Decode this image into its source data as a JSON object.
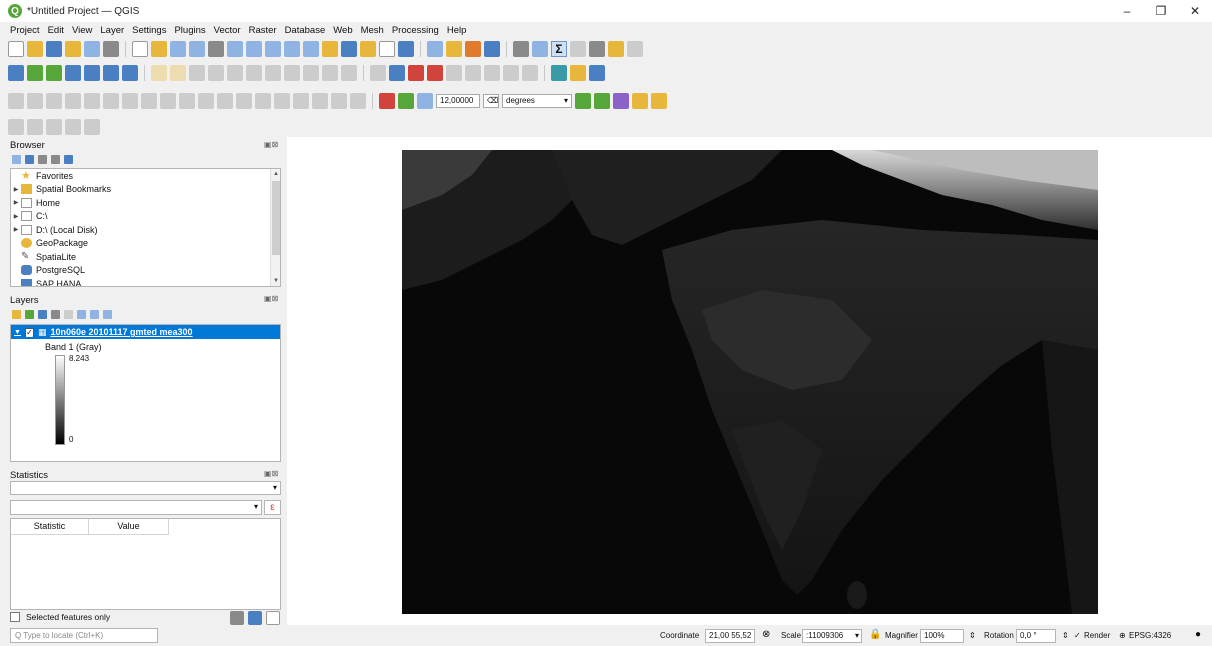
{
  "window": {
    "title": "*Untitled Project — QGIS",
    "app_icon": "Q",
    "controls": [
      "–",
      "❐",
      "✕"
    ]
  },
  "menubar": [
    "Project",
    "Edit",
    "View",
    "Layer",
    "Settings",
    "Plugins",
    "Vector",
    "Raster",
    "Database",
    "Web",
    "Mesh",
    "Processing",
    "Help"
  ],
  "toolbar": {
    "snap_tolerance": "12,00000",
    "units": "degrees"
  },
  "browser": {
    "title": "Browser",
    "items": [
      {
        "label": "Favorites",
        "icon": "star-icon",
        "arrow": ""
      },
      {
        "label": "Spatial Bookmarks",
        "icon": "bookmark-icon",
        "arrow": "▶"
      },
      {
        "label": "Home",
        "icon": "home-folder-icon",
        "arrow": "▶"
      },
      {
        "label": "C:\\",
        "icon": "drive-icon",
        "arrow": "▶"
      },
      {
        "label": "D:\\ (Local Disk)",
        "icon": "drive-icon",
        "arrow": "▶"
      },
      {
        "label": "GeoPackage",
        "icon": "geopackage-icon",
        "arrow": ""
      },
      {
        "label": "SpatiaLite",
        "icon": "spatialite-icon",
        "arrow": ""
      },
      {
        "label": "PostgreSQL",
        "icon": "postgresql-icon",
        "arrow": ""
      },
      {
        "label": "SAP HANA",
        "icon": "saphana-icon",
        "arrow": ""
      }
    ]
  },
  "layers": {
    "title": "Layers",
    "layer_name": "10n060e 20101117 gmted mea300",
    "band_label": "Band 1 (Gray)",
    "max_value": "8.243",
    "min_value": "0"
  },
  "statistics": {
    "title": "Statistics",
    "epsilon": "ε",
    "columns": [
      "Statistic",
      "Value"
    ],
    "selected_only": "Selected features only"
  },
  "locator": {
    "placeholder": "Q  Type to locate (Ctrl+K)"
  },
  "statusbar": {
    "coordinate_label": "Coordinate",
    "coordinate_value": "21,00 55,52",
    "scale_label": "Scale",
    "scale_value": ":11009306",
    "magnifier_label": "Magnifier",
    "magnifier_value": "100%",
    "rotation_label": "Rotation",
    "rotation_value": "0,0 °",
    "render_label": "Render",
    "crs": "EPSG:4326"
  },
  "colors": {
    "selection": "#0078d7",
    "qgis_green": "#57a639"
  }
}
